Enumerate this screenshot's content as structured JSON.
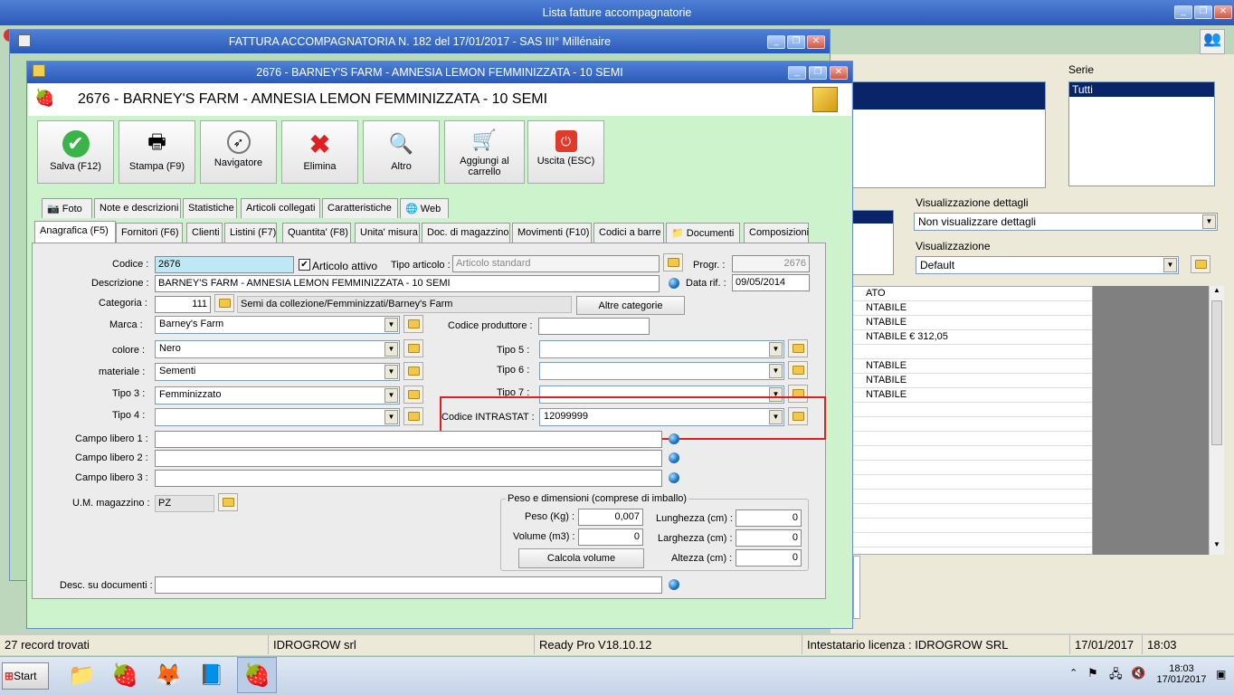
{
  "main_window": {
    "title": "Lista fatture accompagnatorie"
  },
  "invoice_window": {
    "title": "FATTURA ACCOMPAGNATORIA N. 182 del 17/01/2017 - SAS III° Millénaire"
  },
  "article_window": {
    "title": "2676 - BARNEY'S FARM - AMNESIA LEMON FEMMINIZZATA - 10 SEMI",
    "header": "2676 - BARNEY'S FARM - AMNESIA LEMON FEMMINIZZATA - 10 SEMI"
  },
  "toolbar": [
    {
      "label": "Salva (F12)",
      "icon": "check-icon"
    },
    {
      "label": "Stampa (F9)",
      "icon": "printer-icon"
    },
    {
      "label": "Navigatore",
      "icon": "compass-icon"
    },
    {
      "label": "Elimina",
      "icon": "delete-x-icon"
    },
    {
      "label": "Altro",
      "icon": "magnifier-icon"
    },
    {
      "label_1": "Aggiungi al",
      "label_2": "carrello",
      "icon": "cart-icon"
    },
    {
      "label": "Uscita (ESC)",
      "icon": "exit-icon"
    }
  ],
  "tabs_row1": [
    "Foto",
    "Note e descrizioni",
    "Statistiche",
    "Articoli collegati",
    "Caratteristiche",
    "Web"
  ],
  "tabs_row2": [
    "Anagrafica (F5)",
    "Fornitori (F6)",
    "Clienti",
    "Listini (F7)",
    "Quantita' (F8)",
    "Unita' misura",
    "Doc. di magazzino",
    "Movimenti (F10)",
    "Codici a barre",
    "Documenti",
    "Composizioni"
  ],
  "form": {
    "codice_label": "Codice :",
    "codice_value": "2676",
    "articolo_attivo": "Articolo attivo",
    "tipo_articolo_label": "Tipo articolo :",
    "tipo_articolo_value": "Articolo standard",
    "progr_label": "Progr. :",
    "progr_value": "2676",
    "descrizione_label": "Descrizione :",
    "descrizione_value": "BARNEY'S FARM - AMNESIA LEMON FEMMINIZZATA - 10 SEMI",
    "data_rif_label": "Data rif. :",
    "data_rif_value": "09/05/2014",
    "categoria_label": "Categoria :",
    "categoria_value": "111",
    "categoria_path": "Semi da collezione/Femminizzati/Barney's Farm",
    "altre_categorie": "Altre categorie",
    "marca_label": "Marca :",
    "marca_value": "Barney's Farm",
    "codice_produttore_label": "Codice produttore :",
    "colore_label": "colore :",
    "colore_value": "Nero",
    "materiale_label": "materiale :",
    "materiale_value": "Sementi",
    "tipo3_label": "Tipo 3 :",
    "tipo3_value": "Femminizzato",
    "tipo4_label": "Tipo 4 :",
    "tipo5_label": "Tipo 5 :",
    "tipo6_label": "Tipo 6 :",
    "tipo7_label": "Tipo 7 :",
    "intrastat_label": "Codice INTRASTAT :",
    "intrastat_value": "12099999",
    "campo1_label": "Campo libero 1 :",
    "campo2_label": "Campo libero 2 :",
    "campo3_label": "Campo libero 3 :",
    "um_label": "U.M. magazzino :",
    "um_value": "PZ",
    "peso_group": "Peso e dimensioni (comprese di imballo)",
    "peso_label": "Peso (Kg) :",
    "peso_value": "0,007",
    "volume_label": "Volume (m3) :",
    "volume_value": "0",
    "calcola": "Calcola volume",
    "lunghezza_label": "Lunghezza (cm) :",
    "lunghezza_value": "0",
    "larghezza_label": "Larghezza (cm) :",
    "larghezza_value": "0",
    "altezza_label": "Altezza (cm) :",
    "altezza_value": "0",
    "desc_doc_label": "Desc. su documenti :"
  },
  "background": {
    "serie_label": "Serie",
    "serie_value": "Tutti",
    "vis_dettagli_label": "Visualizzazione dettagli",
    "vis_dettagli_value": "Non visualizzare dettagli",
    "vis_label": "Visualizzazione",
    "vis_value": "Default",
    "grid_rows": [
      "ATO",
      "NTABILE",
      "NTABILE",
      "NTABILE  € 312,05",
      "",
      "NTABILE",
      "NTABILE",
      "NTABILE"
    ]
  },
  "statusbar": {
    "records": "27 record trovati",
    "company": "IDROGROW srl",
    "version": "Ready Pro V18.10.12",
    "license": "Intestatario licenza : IDROGROW SRL",
    "date": "17/01/2017",
    "time": "18:03"
  },
  "taskbar": {
    "start": "Start",
    "clock_time": "18:03",
    "clock_date": "17/01/2017"
  }
}
